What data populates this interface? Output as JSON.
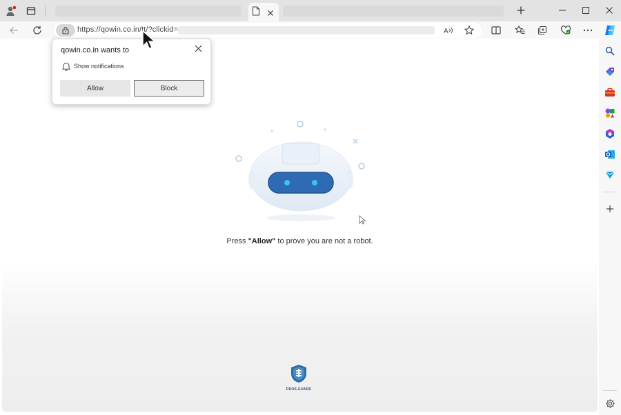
{
  "browser": {
    "url": "https://qowin.co.in/tt/?clickid=",
    "tab_icon": "document-icon"
  },
  "popup": {
    "title": "qowin.co.in wants to",
    "permission": "Show notifications",
    "allow_label": "Allow",
    "block_label": "Block"
  },
  "page": {
    "message_prefix": "Press ",
    "message_bold": "\"Allow\"",
    "message_suffix": " to prove you are not a robot.",
    "ddos_label": "DDOS-GUARD"
  },
  "colors": {
    "robot_visor": "#2f6bb5",
    "robot_eyes": "#38c4f2",
    "ddos_shield": "#2d6ea8",
    "edge_copilot": "#1a73e8"
  }
}
